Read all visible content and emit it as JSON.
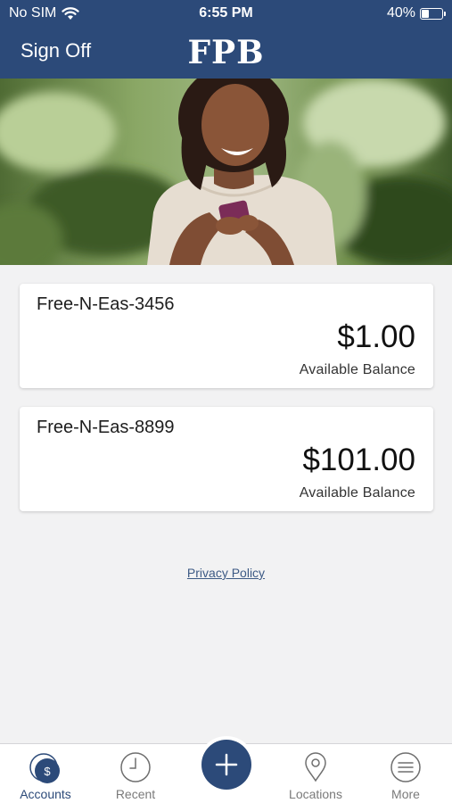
{
  "status_bar": {
    "carrier": "No SIM",
    "time": "6:55 PM",
    "battery": "40%",
    "battery_level": 0.4
  },
  "nav": {
    "sign_off": "Sign Off",
    "logo": "FPB"
  },
  "accounts": [
    {
      "name": "Free-N-Eas-3456",
      "balance": "$1.00",
      "balance_label": "Available Balance"
    },
    {
      "name": "Free-N-Eas-8899",
      "balance": "$101.00",
      "balance_label": "Available Balance"
    }
  ],
  "footer": {
    "privacy_policy": "Privacy Policy"
  },
  "tab_bar": {
    "items": [
      {
        "label": "Accounts",
        "icon": "dollar-circle-icon",
        "active": true
      },
      {
        "label": "Recent",
        "icon": "clock-icon",
        "active": false
      },
      {
        "label": "",
        "icon": "plus-icon",
        "active": false
      },
      {
        "label": "Locations",
        "icon": "location-pin-icon",
        "active": false
      },
      {
        "label": "More",
        "icon": "menu-icon",
        "active": false
      }
    ]
  },
  "colors": {
    "brand": "#2c4a79",
    "background": "#f2f2f3",
    "link": "#3d5a85"
  }
}
